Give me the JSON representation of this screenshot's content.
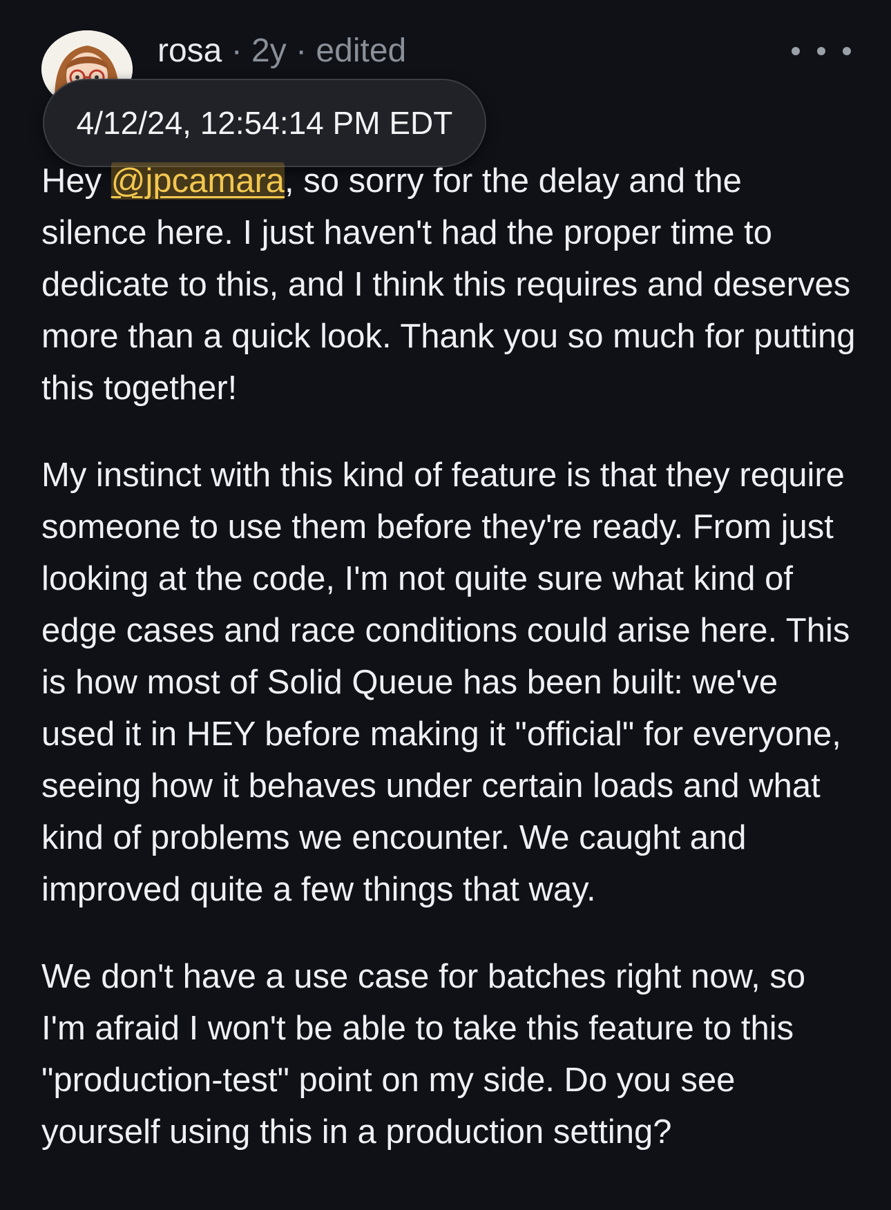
{
  "comment": {
    "author": "rosa",
    "relative_time": "2y",
    "edited_label": "edited",
    "separator": "·",
    "tooltip_timestamp": "4/12/24, 12:54:14 PM EDT",
    "mention": "@jpcamara",
    "paragraph1_before_mention": "Hey ",
    "paragraph1_after_mention": ", so sorry for the delay and the silence here. I just haven't had the proper time to dedicate to this, and I think this requires and deserves more than a quick look. Thank you so much for putting this together!",
    "paragraph2": "My instinct with this kind of feature is that they require someone to use them before they're ready. From just looking at the code, I'm not quite sure what kind of edge cases and race conditions could arise here. This is how most of Solid Queue has been built: we've used it in HEY before making it \"official\" for everyone, seeing how it behaves under certain loads and what kind of problems we encounter. We caught and improved quite a few things that way.",
    "paragraph3": "We don't have a use case for batches right now, so I'm afraid I won't be able to take this feature to this \"production-test\" point on my side. Do you see yourself using this in a production setting?"
  },
  "icons": {
    "avatar": "avatar-illustration",
    "more": "more-horizontal-icon"
  },
  "colors": {
    "background": "#0f1117",
    "text": "#eef0f3",
    "meta": "#8a8f98",
    "mention": "#f3c74f",
    "tooltip_background": "#202227"
  }
}
